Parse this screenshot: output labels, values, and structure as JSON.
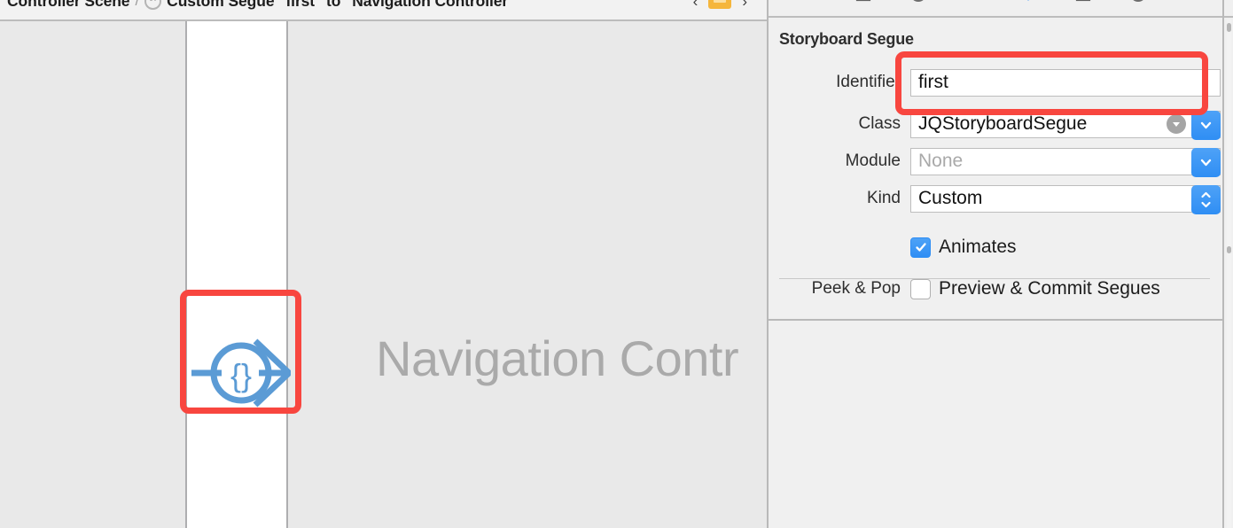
{
  "jumpbar": {
    "crumb_left": "Controller Scene",
    "separator": "/",
    "scene_icon": "segue-circle-icon",
    "crumb_right": "Custom Segue \"first\" to \"Navigation Controller\"",
    "back_chevron": "‹",
    "forward_chevron": "›",
    "folder_icon": "folder-icon"
  },
  "canvas": {
    "background_color": "#e9e9e9",
    "scene_background": "#ffffff",
    "scene_title": "Navigation Contr",
    "scene_title_color": "#aaaaaa",
    "segue_icon_name": "custom-segue-icon",
    "segue_icon_color": "#5b9bd5",
    "annotation_color": "#f8463f"
  },
  "inspector": {
    "toolbar": {
      "tabs": [
        {
          "name": "file-inspector-icon",
          "selected": false
        },
        {
          "name": "quick-help-inspector-icon",
          "selected": false
        },
        {
          "name": "identity-inspector-icon",
          "selected": false
        },
        {
          "name": "attributes-inspector-icon",
          "selected": true
        },
        {
          "name": "size-inspector-icon",
          "selected": false
        },
        {
          "name": "connections-inspector-icon",
          "selected": false
        }
      ],
      "selected_color": "#2f8ef4"
    },
    "section": {
      "title": "Storyboard Segue",
      "rows": [
        {
          "label": "Identifier",
          "value": "first",
          "type": "text",
          "placeholder": ""
        },
        {
          "label": "Class",
          "value": "JQStoryboardSegue",
          "type": "combo-disclose",
          "placeholder": ""
        },
        {
          "label": "Module",
          "value": "",
          "type": "combo",
          "placeholder": "None"
        },
        {
          "label": "Kind",
          "value": "Custom",
          "type": "stepper",
          "placeholder": ""
        }
      ],
      "checkboxes": [
        {
          "prefix": "",
          "label": "Animates",
          "checked": true
        },
        {
          "prefix": "Peek & Pop",
          "label": "Preview & Commit Segues",
          "checked": false
        }
      ]
    }
  }
}
